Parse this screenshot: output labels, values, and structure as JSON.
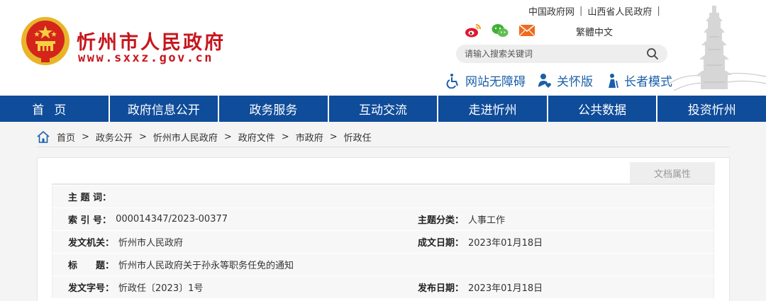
{
  "header": {
    "site_name": "忻州市人民政府",
    "site_domain": "www.sxxz.gov.cn",
    "top_links": [
      "中国政府网",
      "山西省人民政府"
    ],
    "lang_label": "繁體中文",
    "search_placeholder": "请输入搜索关键词",
    "accessibility": [
      {
        "label": "网站无障碍",
        "icon": "wheelchair-icon"
      },
      {
        "label": "关怀版",
        "icon": "care-icon"
      },
      {
        "label": "长者模式",
        "icon": "elder-icon"
      }
    ]
  },
  "nav": {
    "tabs": [
      "首页",
      "政府信息公开",
      "政务服务",
      "互动交流",
      "走进忻州",
      "公共数据",
      "投资忻州"
    ]
  },
  "breadcrumb": [
    "首页",
    "政务公开",
    "忻州市人民政府",
    "政府文件",
    "市政府",
    "忻政任"
  ],
  "doc": {
    "tab_label": "文档属性",
    "rows": [
      {
        "label": "主 题 词：",
        "value": ""
      },
      {
        "label": "索 引 号：",
        "value": "000014347/2023-00377",
        "label2": "主题分类：",
        "value2": "人事工作"
      },
      {
        "label": "发文机关：",
        "value": "忻州市人民政府",
        "label2": "成文日期：",
        "value2": "2023年01月18日"
      },
      {
        "label": "标　　题：",
        "value": "忻州市人民政府关于孙永等职务任免的通知"
      },
      {
        "label": "发文字号：",
        "value": "忻政任〔2023〕1号",
        "label2": "发布日期：",
        "value2": "2023年01月18日"
      }
    ]
  },
  "colors": {
    "brand_red": "#c7161d",
    "nav_blue": "#0f4c9a",
    "link_blue": "#1a5fa8"
  }
}
